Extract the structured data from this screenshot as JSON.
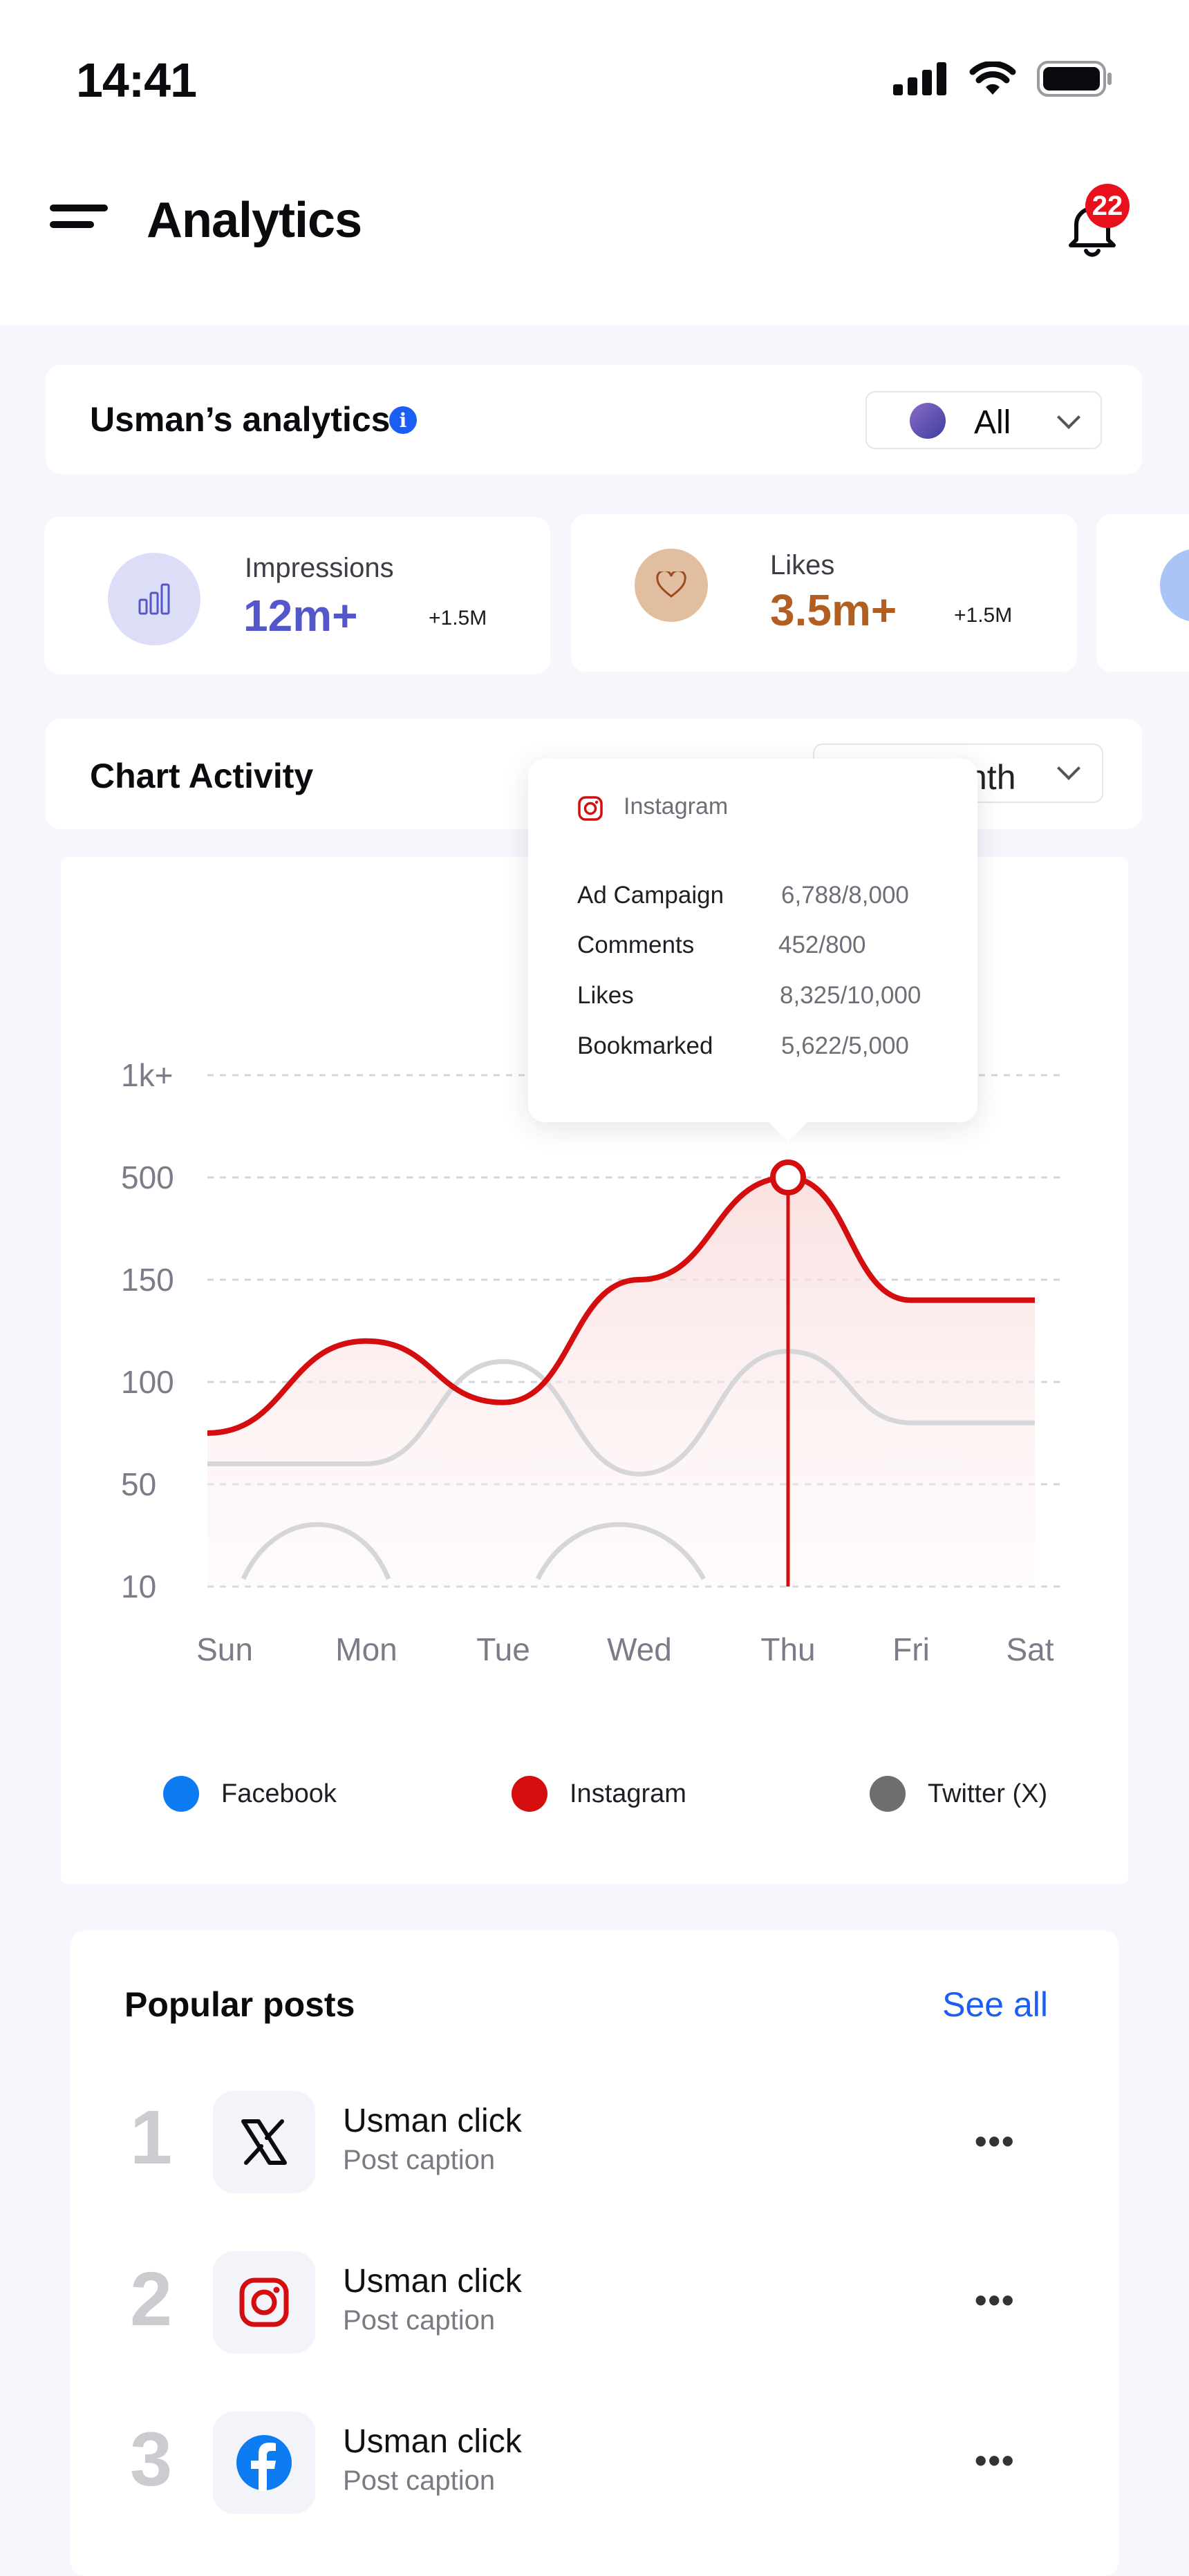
{
  "status_bar": {
    "time": "14:41"
  },
  "header": {
    "title": "Analytics",
    "notification_count": "22"
  },
  "overview": {
    "title": "Usman’s analytics",
    "info_glyph": "i",
    "filter": "All"
  },
  "stats": [
    {
      "label": "Impressions",
      "value": "12m+",
      "delta": "+1.5M",
      "color": "#5457C9",
      "icon": "bar-chart-icon"
    },
    {
      "label": "Likes",
      "value": "3.5m+",
      "delta": "+1.5M",
      "color": "#B25E23",
      "icon": "heart-icon"
    }
  ],
  "chart_activity": {
    "title": "Chart Activity",
    "period_visible": "nth"
  },
  "tooltip": {
    "brand": "Instagram",
    "rows": [
      {
        "label": "Ad Campaign",
        "value": "6,788/8,000"
      },
      {
        "label": "Comments",
        "value": "452/800"
      },
      {
        "label": "Likes",
        "value": "8,325/10,000"
      },
      {
        "label": "Bookmarked",
        "value": "5,622/5,000"
      }
    ]
  },
  "chart_data": {
    "type": "line",
    "y_ticks": [
      "1k+",
      "500",
      "150",
      "100",
      "50",
      "10"
    ],
    "categories": [
      "Sun",
      "Mon",
      "Tue",
      "Wed",
      "Thu",
      "Fri",
      "Sat"
    ],
    "grid": true,
    "highlight_category": "Thu",
    "series": [
      {
        "name": "Instagram",
        "color": "#D40E0E",
        "values": [
          75,
          120,
          90,
          150,
          500,
          140,
          140
        ]
      },
      {
        "name": "Twitter (X)",
        "color": "#D6D6DA",
        "values": [
          60,
          60,
          110,
          55,
          115,
          80,
          80
        ]
      }
    ]
  },
  "legend": [
    {
      "name": "Facebook",
      "color": "#0D7BF2"
    },
    {
      "name": "Instagram",
      "color": "#D40E0E"
    },
    {
      "name": "Twitter (X)",
      "color": "#6E6E70"
    }
  ],
  "popular_posts": {
    "title": "Popular posts",
    "see_all": "See all",
    "items": [
      {
        "rank": "1",
        "name": "Usman click",
        "caption": "Post caption",
        "icon": "x-twitter-icon",
        "more": "•••"
      },
      {
        "rank": "2",
        "name": "Usman click",
        "caption": "Post caption",
        "icon": "instagram-icon",
        "more": "•••"
      },
      {
        "rank": "3",
        "name": "Usman click",
        "caption": "Post caption",
        "icon": "facebook-icon",
        "more": "•••"
      }
    ]
  }
}
